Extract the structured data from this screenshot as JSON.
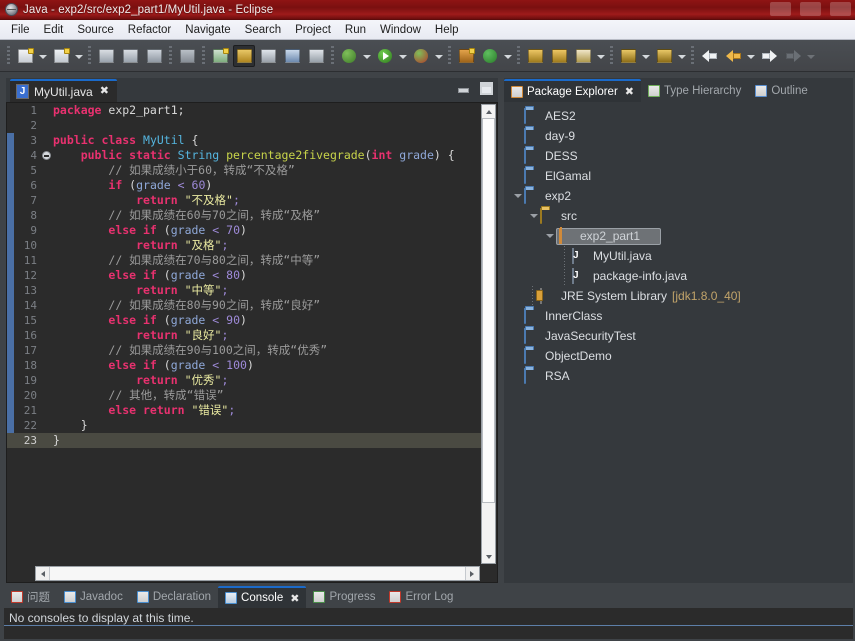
{
  "window": {
    "title": "Java - exp2/src/exp2_part1/MyUtil.java - Eclipse",
    "app_icon": "eclipse-icon",
    "controls": {
      "minimize": "minimize-button",
      "maximize": "maximize-button",
      "close": "close-button"
    }
  },
  "menu": {
    "items": [
      {
        "label": "File"
      },
      {
        "label": "Edit"
      },
      {
        "label": "Source"
      },
      {
        "label": "Refactor"
      },
      {
        "label": "Navigate"
      },
      {
        "label": "Search"
      },
      {
        "label": "Project"
      },
      {
        "label": "Run"
      },
      {
        "label": "Window"
      },
      {
        "label": "Help"
      }
    ]
  },
  "toolbar": {
    "groups": [
      {
        "items": [
          {
            "icon": "new-java-project-icon",
            "arrow": true
          },
          {
            "icon": "new-java-class-icon",
            "arrow": true
          }
        ]
      },
      {
        "items": [
          {
            "icon": "save-icon",
            "arrow": false
          },
          {
            "icon": "save-all-icon",
            "arrow": false
          },
          {
            "icon": "print-icon",
            "arrow": false
          }
        ]
      },
      {
        "items": [
          {
            "icon": "toggle-mark-occurrences-icon",
            "arrow": false
          }
        ]
      },
      {
        "items": [
          {
            "icon": "new-java-annotation-icon",
            "arrow": false
          },
          {
            "icon": "open-task-icon",
            "arrow": false,
            "active": true
          },
          {
            "icon": "search-icon",
            "arrow": false
          },
          {
            "icon": "open-type-icon",
            "arrow": false
          },
          {
            "icon": "last-edit-location-icon",
            "arrow": false
          }
        ]
      },
      {
        "items": [
          {
            "icon": "debug-icon",
            "arrow": true
          },
          {
            "icon": "run-icon",
            "arrow": true
          },
          {
            "icon": "run-coverage-icon",
            "arrow": true
          }
        ]
      },
      {
        "items": [
          {
            "icon": "new-junit-test-icon",
            "arrow": false
          },
          {
            "icon": "refresh-icon",
            "arrow": true
          }
        ]
      },
      {
        "items": [
          {
            "icon": "open-folder-icon",
            "arrow": false
          },
          {
            "icon": "folder-icon",
            "arrow": false
          },
          {
            "icon": "edit-pencil-icon",
            "arrow": true
          }
        ]
      },
      {
        "items": [
          {
            "icon": "import-icon",
            "arrow": true
          },
          {
            "icon": "export-icon",
            "arrow": true
          }
        ]
      },
      {
        "items": [
          {
            "icon": "back-icon",
            "arrow": false
          },
          {
            "icon": "previous-annotation-icon",
            "arrow": true
          },
          {
            "icon": "forward-icon",
            "arrow": false
          },
          {
            "icon": "next-icon-disabled",
            "arrow": true,
            "dim": true
          }
        ]
      }
    ]
  },
  "editor": {
    "tab": {
      "label": "MyUtil.java",
      "icon": "java-file-icon",
      "close": "✖"
    },
    "tools": {
      "minimize": "minimize-editor-icon",
      "maximize": "maximize-editor-icon"
    },
    "current_line": 23,
    "fold_line": 4,
    "lines": [
      {
        "n": 1,
        "tokens": [
          {
            "t": "package ",
            "c": "kw"
          },
          {
            "t": "exp2_part1;",
            "c": "pln"
          }
        ]
      },
      {
        "n": 2,
        "tokens": []
      },
      {
        "n": 3,
        "tokens": [
          {
            "t": "public class ",
            "c": "kw"
          },
          {
            "t": "MyUtil",
            "c": "cls"
          },
          {
            "t": " {",
            "c": "pln"
          }
        ]
      },
      {
        "n": 4,
        "tokens": [
          {
            "t": "    ",
            "c": "pln"
          },
          {
            "t": "public static ",
            "c": "kw"
          },
          {
            "t": "String",
            "c": "cls"
          },
          {
            "t": " ",
            "c": "pln"
          },
          {
            "t": "percentage2fivegrade",
            "c": "mth"
          },
          {
            "t": "(",
            "c": "pln"
          },
          {
            "t": "int",
            "c": "kw"
          },
          {
            "t": " ",
            "c": "pln"
          },
          {
            "t": "grade",
            "c": "typ"
          },
          {
            "t": ") {",
            "c": "pln"
          }
        ]
      },
      {
        "n": 5,
        "tokens": [
          {
            "t": "        ",
            "c": "pln"
          },
          {
            "t": "// 如果成绩小于60，转成“不及格”",
            "c": "com"
          }
        ]
      },
      {
        "n": 6,
        "tokens": [
          {
            "t": "        ",
            "c": "pln"
          },
          {
            "t": "if",
            "c": "kw"
          },
          {
            "t": " (",
            "c": "pln"
          },
          {
            "t": "grade",
            "c": "typ"
          },
          {
            "t": " ",
            "c": "pln"
          },
          {
            "t": "<",
            "c": "num2"
          },
          {
            "t": " ",
            "c": "pln"
          },
          {
            "t": "60",
            "c": "num2"
          },
          {
            "t": ")",
            "c": "pln"
          }
        ]
      },
      {
        "n": 7,
        "tokens": [
          {
            "t": "            ",
            "c": "pln"
          },
          {
            "t": "return",
            "c": "kw"
          },
          {
            "t": " ",
            "c": "pln"
          },
          {
            "t": "\"不及格\"",
            "c": "str"
          },
          {
            "t": ";",
            "c": "num2"
          }
        ]
      },
      {
        "n": 8,
        "tokens": [
          {
            "t": "        ",
            "c": "pln"
          },
          {
            "t": "// 如果成绩在60与70之间，转成“及格”",
            "c": "com"
          }
        ]
      },
      {
        "n": 9,
        "tokens": [
          {
            "t": "        ",
            "c": "pln"
          },
          {
            "t": "else if",
            "c": "kw"
          },
          {
            "t": " (",
            "c": "pln"
          },
          {
            "t": "grade",
            "c": "typ"
          },
          {
            "t": " ",
            "c": "pln"
          },
          {
            "t": "<",
            "c": "num2"
          },
          {
            "t": " ",
            "c": "pln"
          },
          {
            "t": "70",
            "c": "num2"
          },
          {
            "t": ")",
            "c": "pln"
          }
        ]
      },
      {
        "n": 10,
        "tokens": [
          {
            "t": "            ",
            "c": "pln"
          },
          {
            "t": "return",
            "c": "kw"
          },
          {
            "t": " ",
            "c": "pln"
          },
          {
            "t": "\"及格\"",
            "c": "str"
          },
          {
            "t": ";",
            "c": "num2"
          }
        ]
      },
      {
        "n": 11,
        "tokens": [
          {
            "t": "        ",
            "c": "pln"
          },
          {
            "t": "// 如果成绩在70与80之间，转成“中等”",
            "c": "com"
          }
        ]
      },
      {
        "n": 12,
        "tokens": [
          {
            "t": "        ",
            "c": "pln"
          },
          {
            "t": "else if",
            "c": "kw"
          },
          {
            "t": " (",
            "c": "pln"
          },
          {
            "t": "grade",
            "c": "typ"
          },
          {
            "t": " ",
            "c": "pln"
          },
          {
            "t": "<",
            "c": "num2"
          },
          {
            "t": " ",
            "c": "pln"
          },
          {
            "t": "80",
            "c": "num2"
          },
          {
            "t": ")",
            "c": "pln"
          }
        ]
      },
      {
        "n": 13,
        "tokens": [
          {
            "t": "            ",
            "c": "pln"
          },
          {
            "t": "return",
            "c": "kw"
          },
          {
            "t": " ",
            "c": "pln"
          },
          {
            "t": "\"中等\"",
            "c": "str"
          },
          {
            "t": ";",
            "c": "num2"
          }
        ]
      },
      {
        "n": 14,
        "tokens": [
          {
            "t": "        ",
            "c": "pln"
          },
          {
            "t": "// 如果成绩在80与90之间，转成“良好”",
            "c": "com"
          }
        ]
      },
      {
        "n": 15,
        "tokens": [
          {
            "t": "        ",
            "c": "pln"
          },
          {
            "t": "else if",
            "c": "kw"
          },
          {
            "t": " (",
            "c": "pln"
          },
          {
            "t": "grade",
            "c": "typ"
          },
          {
            "t": " ",
            "c": "pln"
          },
          {
            "t": "<",
            "c": "num2"
          },
          {
            "t": " ",
            "c": "pln"
          },
          {
            "t": "90",
            "c": "num2"
          },
          {
            "t": ")",
            "c": "pln"
          }
        ]
      },
      {
        "n": 16,
        "tokens": [
          {
            "t": "            ",
            "c": "pln"
          },
          {
            "t": "return",
            "c": "kw"
          },
          {
            "t": " ",
            "c": "pln"
          },
          {
            "t": "\"良好\"",
            "c": "str"
          },
          {
            "t": ";",
            "c": "num2"
          }
        ]
      },
      {
        "n": 17,
        "tokens": [
          {
            "t": "        ",
            "c": "pln"
          },
          {
            "t": "// 如果成绩在90与100之间，转成“优秀”",
            "c": "com"
          }
        ]
      },
      {
        "n": 18,
        "tokens": [
          {
            "t": "        ",
            "c": "pln"
          },
          {
            "t": "else if",
            "c": "kw"
          },
          {
            "t": " (",
            "c": "pln"
          },
          {
            "t": "grade",
            "c": "typ"
          },
          {
            "t": " ",
            "c": "pln"
          },
          {
            "t": "<",
            "c": "num2"
          },
          {
            "t": " ",
            "c": "pln"
          },
          {
            "t": "100",
            "c": "num2"
          },
          {
            "t": ")",
            "c": "pln"
          }
        ]
      },
      {
        "n": 19,
        "tokens": [
          {
            "t": "            ",
            "c": "pln"
          },
          {
            "t": "return",
            "c": "kw"
          },
          {
            "t": " ",
            "c": "pln"
          },
          {
            "t": "\"优秀\"",
            "c": "str"
          },
          {
            "t": ";",
            "c": "num2"
          }
        ]
      },
      {
        "n": 20,
        "tokens": [
          {
            "t": "        ",
            "c": "pln"
          },
          {
            "t": "// 其他，转成“错误”",
            "c": "com"
          }
        ]
      },
      {
        "n": 21,
        "tokens": [
          {
            "t": "        ",
            "c": "pln"
          },
          {
            "t": "else return",
            "c": "kw"
          },
          {
            "t": " ",
            "c": "pln"
          },
          {
            "t": "\"错误\"",
            "c": "str"
          },
          {
            "t": ";",
            "c": "num2"
          }
        ]
      },
      {
        "n": 22,
        "tokens": [
          {
            "t": "    }",
            "c": "pln"
          }
        ]
      },
      {
        "n": 23,
        "tokens": [
          {
            "t": "}",
            "c": "pln"
          }
        ]
      }
    ]
  },
  "explorer": {
    "tabs": [
      {
        "label": "Package Explorer",
        "icon": "package-explorer-icon",
        "active": true,
        "close": "✖"
      },
      {
        "label": "Type Hierarchy",
        "icon": "type-hierarchy-icon",
        "active": false
      },
      {
        "label": "Outline",
        "icon": "outline-icon",
        "active": false
      }
    ],
    "tree": [
      {
        "label": "AES2",
        "icon": "folder-icon",
        "indent": 1,
        "twist": "none",
        "selected": false
      },
      {
        "label": "day-9",
        "icon": "folder-icon",
        "indent": 1,
        "twist": "none",
        "selected": false
      },
      {
        "label": "DESS",
        "icon": "folder-icon",
        "indent": 1,
        "twist": "none",
        "selected": false
      },
      {
        "label": "ElGamal",
        "icon": "folder-icon",
        "indent": 1,
        "twist": "none",
        "selected": false
      },
      {
        "label": "exp2",
        "icon": "java-project-icon",
        "indent": 1,
        "twist": "open",
        "selected": false
      },
      {
        "label": "src",
        "icon": "source-folder-icon",
        "indent": 2,
        "twist": "open",
        "selected": false
      },
      {
        "label": "exp2_part1",
        "icon": "package-icon",
        "indent": 3,
        "twist": "open",
        "selected": true
      },
      {
        "label": "MyUtil.java",
        "icon": "java-file-icon",
        "indent": 4,
        "twist": "dots",
        "selected": false
      },
      {
        "label": "package-info.java",
        "icon": "java-file-icon",
        "indent": 4,
        "twist": "dots",
        "selected": false
      },
      {
        "label": "JRE System Library",
        "suffix": "[jdk1.8.0_40]",
        "icon": "jre-library-icon",
        "indent": 2,
        "twist": "dots",
        "selected": false
      },
      {
        "label": "InnerClass",
        "icon": "folder-icon",
        "indent": 1,
        "twist": "none",
        "selected": false
      },
      {
        "label": "JavaSecurityTest",
        "icon": "folder-icon",
        "indent": 1,
        "twist": "none",
        "selected": false
      },
      {
        "label": "ObjectDemo",
        "icon": "folder-icon",
        "indent": 1,
        "twist": "none",
        "selected": false
      },
      {
        "label": "RSA",
        "icon": "folder-icon",
        "indent": 1,
        "twist": "none",
        "selected": false
      }
    ]
  },
  "bottom": {
    "tabs": [
      {
        "label": "问题",
        "icon": "problems-icon",
        "active": false
      },
      {
        "label": "Javadoc",
        "icon": "javadoc-icon",
        "active": false
      },
      {
        "label": "Declaration",
        "icon": "declaration-icon",
        "active": false
      },
      {
        "label": "Console",
        "icon": "console-icon",
        "active": true,
        "close": "✖"
      },
      {
        "label": "Progress",
        "icon": "progress-icon",
        "active": false
      },
      {
        "label": "Error Log",
        "icon": "error-log-icon",
        "active": false
      }
    ],
    "console_message": "No consoles to display at this time."
  },
  "colors": {
    "titlebar": "#8f1414",
    "tab_accent": "#1b6ac9",
    "editor_bg": "#2b2b2b",
    "panel_bg": "#35393d",
    "keyword": "#e8316f",
    "class_name": "#55b6e0",
    "method_name": "#c8d44a",
    "string": "#e9e9a0",
    "comment": "#9b9b9b",
    "number": "#9e8ad8",
    "suffix": "#c2a46a"
  }
}
